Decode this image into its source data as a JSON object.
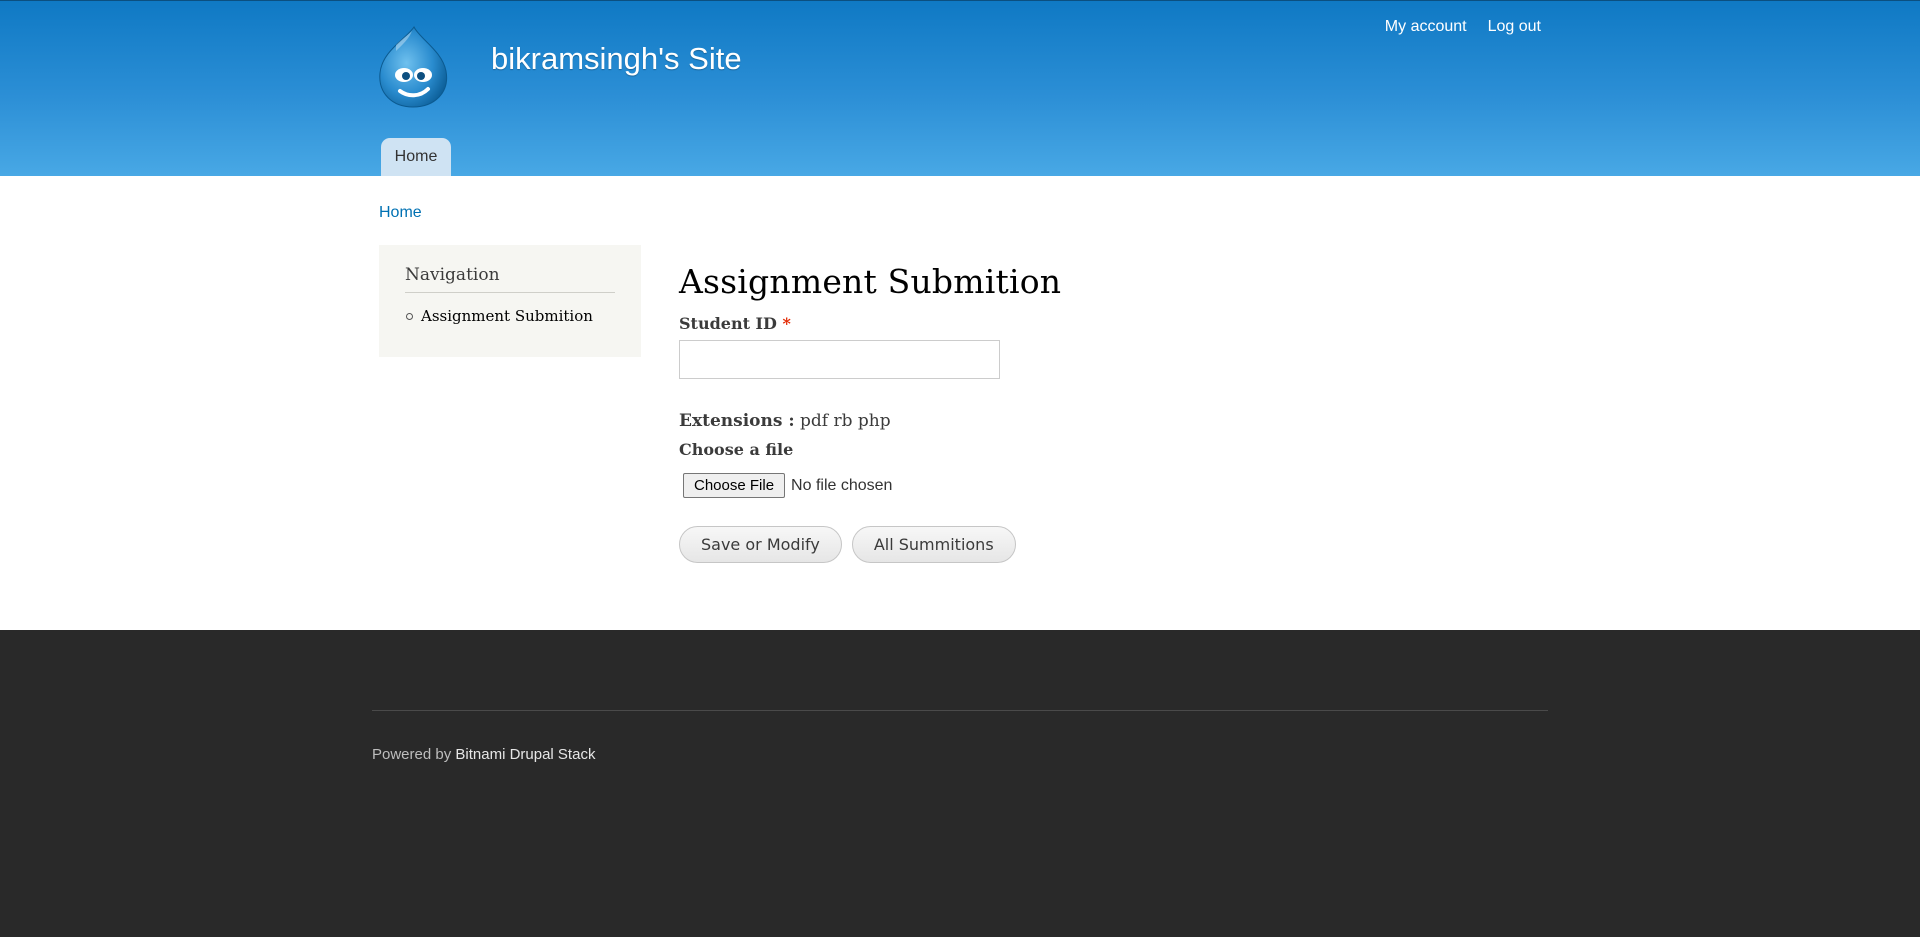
{
  "header": {
    "site_name": "bikramsingh's Site",
    "logo_icon": "drupal-drop-icon",
    "secondary_menu": {
      "my_account": "My account",
      "log_out": "Log out"
    },
    "main_menu": {
      "home": "Home"
    },
    "colors": {
      "gradient_top": "#0f79c4",
      "gradient_bottom": "#48a8e5",
      "active_tab": "#cfe3f3"
    }
  },
  "breadcrumb": {
    "home": "Home"
  },
  "sidebar": {
    "title": "Navigation",
    "items": [
      {
        "label": "Assignment Submition"
      }
    ]
  },
  "form": {
    "page_title": "Assignment Submition",
    "student_id_label": "Student ID",
    "required_marker": "*",
    "student_id_value": "",
    "extensions_label": "Extensions :",
    "extensions_value": "pdf rb php",
    "choose_file_label": "Choose a file",
    "file_button_label": "Choose File",
    "file_status": "No file chosen",
    "save_button": "Save or Modify",
    "all_button": "All Summitions"
  },
  "footer": {
    "powered_by": "Powered by",
    "powered_link": "Bitnami Drupal Stack"
  }
}
